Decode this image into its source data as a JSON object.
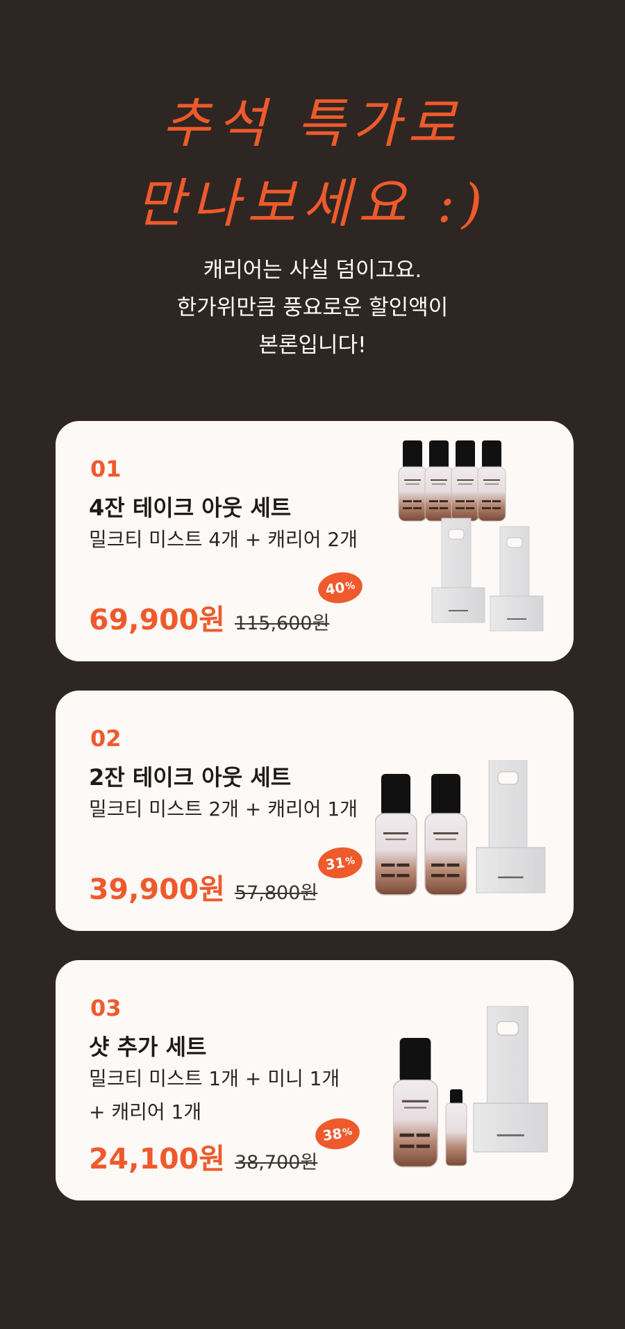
{
  "hero": {
    "title_lines": [
      "추석 특가로",
      "만나보세요 :)"
    ],
    "subtitle_lines": [
      "캐리어는 사실 덤이고요.",
      "한가위만큼 풍요로운 할인액이",
      "본론입니다!"
    ]
  },
  "colors": {
    "background": "#2e2622",
    "accent": "#ee5a2c",
    "card": "#fcf9f6"
  },
  "products": [
    {
      "number": "01",
      "name": "4잔 테이크 아웃 세트",
      "desc_lines": [
        "밀크티 미스트 4개 + 캐리어 2개"
      ],
      "price": "69,900원",
      "original_price": "115,600원",
      "discount_value": "40",
      "discount_unit": "%"
    },
    {
      "number": "02",
      "name": "2잔 테이크 아웃 세트",
      "desc_lines": [
        "밀크티 미스트 2개 + 캐리어 1개"
      ],
      "price": "39,900원",
      "original_price": "57,800원",
      "discount_value": "31",
      "discount_unit": "%"
    },
    {
      "number": "03",
      "name": "샷 추가 세트",
      "desc_lines": [
        "밀크티 미스트 1개 + 미니 1개",
        "+ 캐리어 1개"
      ],
      "price": "24,100원",
      "original_price": "38,700원",
      "discount_value": "38",
      "discount_unit": "%"
    }
  ]
}
